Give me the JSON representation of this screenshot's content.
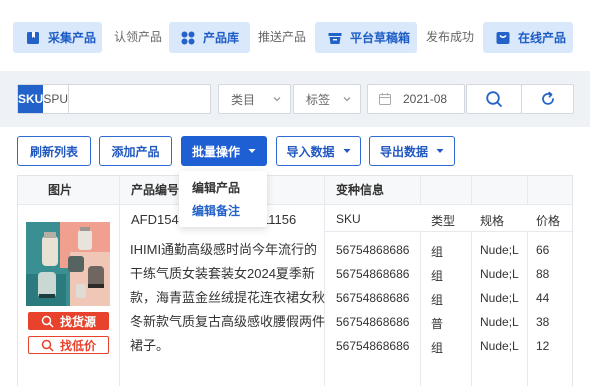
{
  "steps": {
    "collect": "采集产品",
    "claim": "认领产品",
    "library": "产品库",
    "push": "推送产品",
    "drafts": "平台草稿箱",
    "publish_ok": "发布成功",
    "online": "在线产品"
  },
  "filters": {
    "sku_tab": "SKU",
    "spu_tab": "SPU",
    "search_value": "",
    "category_placeholder": "类目",
    "tag_placeholder": "标签",
    "date_value": "2021-08"
  },
  "actions": {
    "refresh": "刷新列表",
    "add": "添加产品",
    "batch": "批量操作",
    "import": "导入数据",
    "export": "导出数据"
  },
  "batch_menu": [
    "编辑产品",
    "编辑备注"
  ],
  "table": {
    "headers": {
      "image": "图片",
      "code": "产品编号",
      "variants": "变种信息",
      "col_sku": "SKU",
      "col_type": "类型",
      "col_spec": "规格",
      "col_price": "价格"
    },
    "row": {
      "code_left": "AFD1545",
      "code_right": "11156",
      "title": "IHIMI通勤高级感时尚今年流行的干练气质女装套装女2024夏季新款，海青蓝金丝绒提花连衣裙女秋冬新款气质复古高级感收腰假两件裙子。",
      "find_source": "找货源",
      "find_lowest": "找低价",
      "variants": [
        {
          "sku": "56754868686",
          "type": "组",
          "spec": "Nude;L",
          "price": "66"
        },
        {
          "sku": "56754868686",
          "type": "组",
          "spec": "Nude;L",
          "price": "88"
        },
        {
          "sku": "56754868686",
          "type": "组",
          "spec": "Nude;L",
          "price": "44"
        },
        {
          "sku": "56754868686",
          "type": "普",
          "spec": "Nude;L",
          "price": "38"
        },
        {
          "sku": "56754868686",
          "type": "组",
          "spec": "Nude;L",
          "price": "12"
        }
      ]
    }
  },
  "colors": {
    "primary": "#1f5fd4",
    "step_bg": "#d9e8fb",
    "accent_red": "#e8422d",
    "filter_bg": "#eef2f7"
  }
}
